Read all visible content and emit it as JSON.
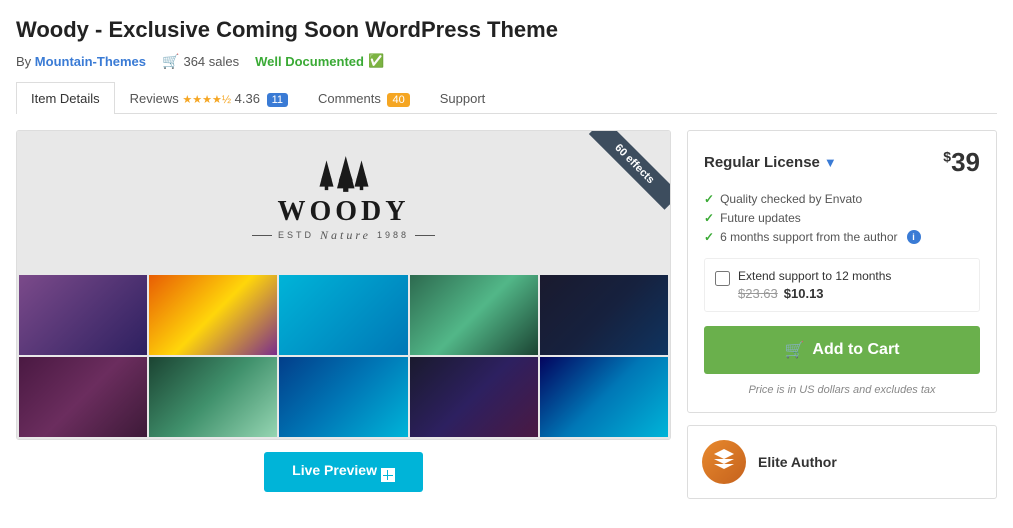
{
  "page": {
    "title": "Woody - Exclusive Coming Soon WordPress Theme",
    "meta": {
      "by_label": "By",
      "author": "Mountain-Themes",
      "sales": "364 sales",
      "documented": "Well Documented"
    },
    "tabs": [
      {
        "id": "item-details",
        "label": "Item Details",
        "active": true,
        "badge": null
      },
      {
        "id": "reviews",
        "label": "Reviews",
        "stars": "★★★★½",
        "rating": "4.36",
        "badge": "11",
        "badge_color": "blue"
      },
      {
        "id": "comments",
        "label": "Comments",
        "badge": "40",
        "badge_color": "orange"
      },
      {
        "id": "support",
        "label": "Support",
        "badge": null
      }
    ],
    "preview": {
      "ribbon_text": "60 effects",
      "logo_trees": "🌲🌲🌲",
      "logo_name": "WOODY",
      "estd_label": "ESTD",
      "estd_year": "1988",
      "nature_label": "Nature"
    },
    "live_preview_btn": "Live Preview",
    "sidebar": {
      "license_label": "Regular License",
      "price_symbol": "$",
      "price": "39",
      "features": [
        {
          "text": "Quality checked by Envato"
        },
        {
          "text": "Future updates"
        },
        {
          "text": "6 months support from the author",
          "info": true
        }
      ],
      "extend_label": "Extend support to 12 months",
      "extend_old_price": "$23.63",
      "extend_new_price": "$10.13",
      "add_to_cart": "Add to Cart",
      "price_note": "Price is in US dollars and excludes tax",
      "author": {
        "badge": "Elite Author"
      }
    }
  }
}
